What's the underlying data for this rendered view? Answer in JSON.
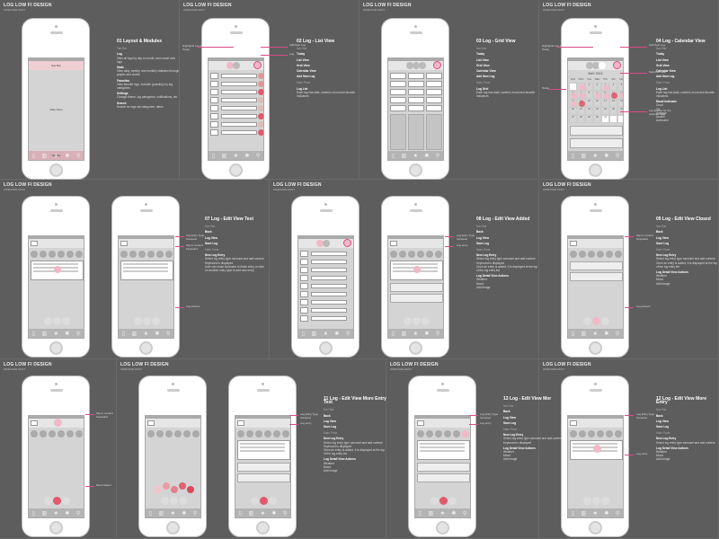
{
  "header": {
    "title": "LOG LOW FI DESIGN",
    "subtitle": "WIREFRAME DRAFT"
  },
  "colors": {
    "accent": "#d84b8a",
    "pink_light": "#f0b9c6",
    "red": "#e05a6b",
    "bg": "#5d5d5d"
  },
  "tab_icons": [
    "log-icon",
    "stats-icon",
    "star-icon",
    "gear-icon",
    "search-icon"
  ],
  "layout_labels": {
    "nav": "Nav Bar",
    "main": "Main Pane",
    "tab": "Tab Bar"
  },
  "calendar": {
    "month": "MAY 2013",
    "days": [
      "SUN",
      "MON",
      "TUE",
      "WED",
      "THU",
      "FRI",
      "SAT"
    ]
  },
  "screens": [
    {
      "title": "01 Layout & Modules",
      "lines": [
        [
          "h",
          "Tab Bar"
        ],
        [
          "b",
          "Log"
        ],
        [
          "",
          "View all logs by day or month, and create new logs"
        ],
        [
          "b",
          "Stats"
        ],
        [
          "",
          "View daily, weekly, and monthly statistics through graphs and charts"
        ],
        [
          "b",
          "Favorites"
        ],
        [
          "",
          "View favorite logs, sortable (possibly) by log categories"
        ],
        [
          "b",
          "Settings"
        ],
        [
          "",
          "Change theme, log categories, notifications, etc."
        ],
        [
          "b",
          "Search"
        ],
        [
          "",
          "Search for logs via categories, dates"
        ]
      ]
    },
    {
      "title": "02 Log - List View",
      "lines": [
        [
          "h",
          "Nav Bar"
        ],
        [
          "b",
          "Today"
        ],
        [
          "b",
          "List View"
        ],
        [
          "b",
          "Grid View"
        ],
        [
          "b",
          "Calendar View"
        ],
        [
          "b",
          "Add New Log"
        ],
        [
          "h",
          "Main Pane"
        ],
        [
          "b",
          "Log List"
        ],
        [
          "",
          "Each log has date, content, mood and favorite indicators"
        ]
      ]
    },
    {
      "title": "03 Log - Grid View",
      "lines": [
        [
          "h",
          "Nav Bar"
        ],
        [
          "b",
          "Today"
        ],
        [
          "b",
          "List View"
        ],
        [
          "b",
          "Grid View"
        ],
        [
          "b",
          "Calendar View"
        ],
        [
          "b",
          "Add New Log"
        ],
        [
          "h",
          "Main Pane"
        ],
        [
          "b",
          "Log Grid"
        ],
        [
          "",
          "Each log has date, content, mood and favorite indicators"
        ]
      ]
    },
    {
      "title": "04 Log - Calendar View",
      "lines": [
        [
          "h",
          "Nav Bar"
        ],
        [
          "b",
          "Today"
        ],
        [
          "b",
          "List View"
        ],
        [
          "b",
          "Grid View"
        ],
        [
          "b",
          "Calendar View"
        ],
        [
          "b",
          "Add New Log"
        ],
        [
          "h",
          "Main Pane"
        ],
        [
          "b",
          "Log List"
        ],
        [
          "",
          "Each log has date, content, mood and favorite indicators"
        ],
        [
          "b",
          "Mood Indicator"
        ],
        [
          "",
          "Good"
        ],
        [
          "",
          "OK"
        ],
        [
          "",
          "Average"
        ],
        [
          "",
          "Unwell"
        ],
        [
          "",
          "Awesome"
        ]
      ]
    },
    {
      "title": "07 Log - Edit View Text",
      "lines": [
        [
          "h",
          "Nav Bar"
        ],
        [
          "b",
          "Back"
        ],
        [
          "b",
          "Log View"
        ],
        [
          "b",
          "Save Log"
        ],
        [
          "h",
          "Main Pane"
        ],
        [
          "b",
          "New Log Entry"
        ],
        [
          "",
          "Select log entry type carousel and add content"
        ],
        [
          "",
          "Keyboard is displayed"
        ],
        [
          "",
          "User can close keyboard to finish entry or click on another entry type to add new entry"
        ]
      ]
    },
    {
      "title": "08 Log - Edit View Added",
      "lines": [
        [
          "h",
          "Nav Bar"
        ],
        [
          "b",
          "Back"
        ],
        [
          "b",
          "Log View"
        ],
        [
          "b",
          "Save Log"
        ],
        [
          "h",
          "Main Pane"
        ],
        [
          "b",
          "New Log Entry"
        ],
        [
          "",
          "Select log entry type carousel and add content"
        ],
        [
          "",
          "Keyboard is displayed"
        ],
        [
          "",
          "Once an entry is added, it is displayed at the top of the log entry list"
        ],
        [
          "b",
          "Log Detail View Actions"
        ],
        [
          "",
          "Weather"
        ],
        [
          "",
          "Mood"
        ],
        [
          "",
          "Add Image"
        ]
      ]
    },
    {
      "title": "09 Log - Edit View Closed",
      "lines": [
        [
          "h",
          "Nav Bar"
        ],
        [
          "b",
          "Back"
        ],
        [
          "b",
          "Log View"
        ],
        [
          "b",
          "Save Log"
        ],
        [
          "h",
          "Main Pane"
        ],
        [
          "b",
          "New Log Entry"
        ],
        [
          "",
          "Select log entry type carousel and add content"
        ],
        [
          "",
          "Once an entry is added, it is displayed at the top of the log entry list"
        ],
        [
          "b",
          "Log Detail View Actions"
        ],
        [
          "",
          "Weather"
        ],
        [
          "",
          "Mood"
        ],
        [
          "",
          "Add Image"
        ]
      ]
    },
    {
      "title": "11 Log - Edit View More Entry Text",
      "lines": [
        [
          "h",
          "Nav Bar"
        ],
        [
          "b",
          "Back"
        ],
        [
          "b",
          "Log View"
        ],
        [
          "b",
          "Save Log"
        ],
        [
          "h",
          "Main Pane"
        ],
        [
          "b",
          "New Log Entry"
        ],
        [
          "",
          "Select log entry type carousel and add content"
        ],
        [
          "",
          "Keyboard is displayed"
        ],
        [
          "",
          "Once an entry is added, it is displayed at the top of the log entry list"
        ],
        [
          "b",
          "Log Detail View Actions"
        ],
        [
          "",
          "Weather"
        ],
        [
          "",
          "Mood"
        ],
        [
          "",
          "Add Image"
        ]
      ]
    },
    {
      "title": "13 Log - Edit View Mor",
      "lines": [
        [
          "h",
          "Nav Bar"
        ],
        [
          "b",
          "Back"
        ],
        [
          "b",
          "Log View"
        ],
        [
          "b",
          "Save Log"
        ],
        [
          "h",
          "Main Pane"
        ],
        [
          "b",
          "New Log Entry"
        ],
        [
          "",
          "Select log entry type carousel and add content"
        ],
        [
          "",
          "Keyboard is displayed"
        ],
        [
          "b",
          "Log Detail View Actions"
        ],
        [
          "",
          "Weather"
        ],
        [
          "",
          "Mood"
        ],
        [
          "",
          "Add Image"
        ]
      ]
    },
    {
      "title": "12 Log - Edit View More Entry",
      "lines": [
        [
          "h",
          "Nav Bar"
        ],
        [
          "b",
          "Back"
        ],
        [
          "b",
          "Log View"
        ],
        [
          "b",
          "Save Log"
        ],
        [
          "h",
          "Main Pane"
        ],
        [
          "b",
          "New Log Entry"
        ],
        [
          "",
          "Select log entry type carousel and add content"
        ],
        [
          "b",
          "Log Detail View Actions"
        ],
        [
          "",
          "Weather"
        ],
        [
          "",
          "Mood"
        ],
        [
          "",
          "Add Image"
        ]
      ]
    }
  ],
  "annotations": {
    "highlight_today": "Highlights Log for Today",
    "add_new_log": "Add New Log",
    "log_label": "Log",
    "today": "Today",
    "selected_date": "Selected Date",
    "log_entries": "Log Entries for the selected date",
    "entry_type": "Log Entry Type Carousel",
    "tap_content": "Tap to content Keyboard",
    "log_actions": "Log Actions",
    "log_entry": "Log entry",
    "mood_select": "Mood Select"
  }
}
